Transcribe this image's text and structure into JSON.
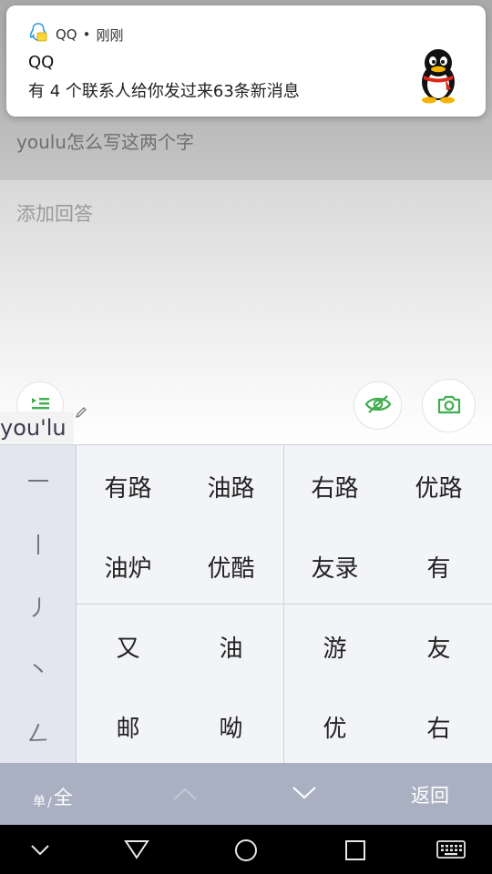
{
  "background": {
    "question_text": "youlu怎么写这两个字",
    "answer_placeholder": "添加回答"
  },
  "notification": {
    "app_name": "QQ",
    "time": "刚刚",
    "title": "QQ",
    "body": "有 4 个联系人给你发过来63条新消息"
  },
  "pinyin": "you'lu",
  "keyboard": {
    "strokes": [
      "一",
      "丨",
      "丿",
      "丶",
      "𠃋"
    ],
    "candidates": [
      [
        "有路",
        "油路",
        "右路",
        "优路"
      ],
      [
        "油炉",
        "优酷",
        "友录",
        "有"
      ],
      [
        "又",
        "油",
        "游",
        "友"
      ],
      [
        "邮",
        "呦",
        "优",
        "右"
      ]
    ],
    "mode_single": "单",
    "mode_separator": "/",
    "mode_full": "全",
    "back_label": "返回"
  },
  "colors": {
    "accent_green": "#3fae4f",
    "keyboard_bar": "#a9b0c2"
  }
}
